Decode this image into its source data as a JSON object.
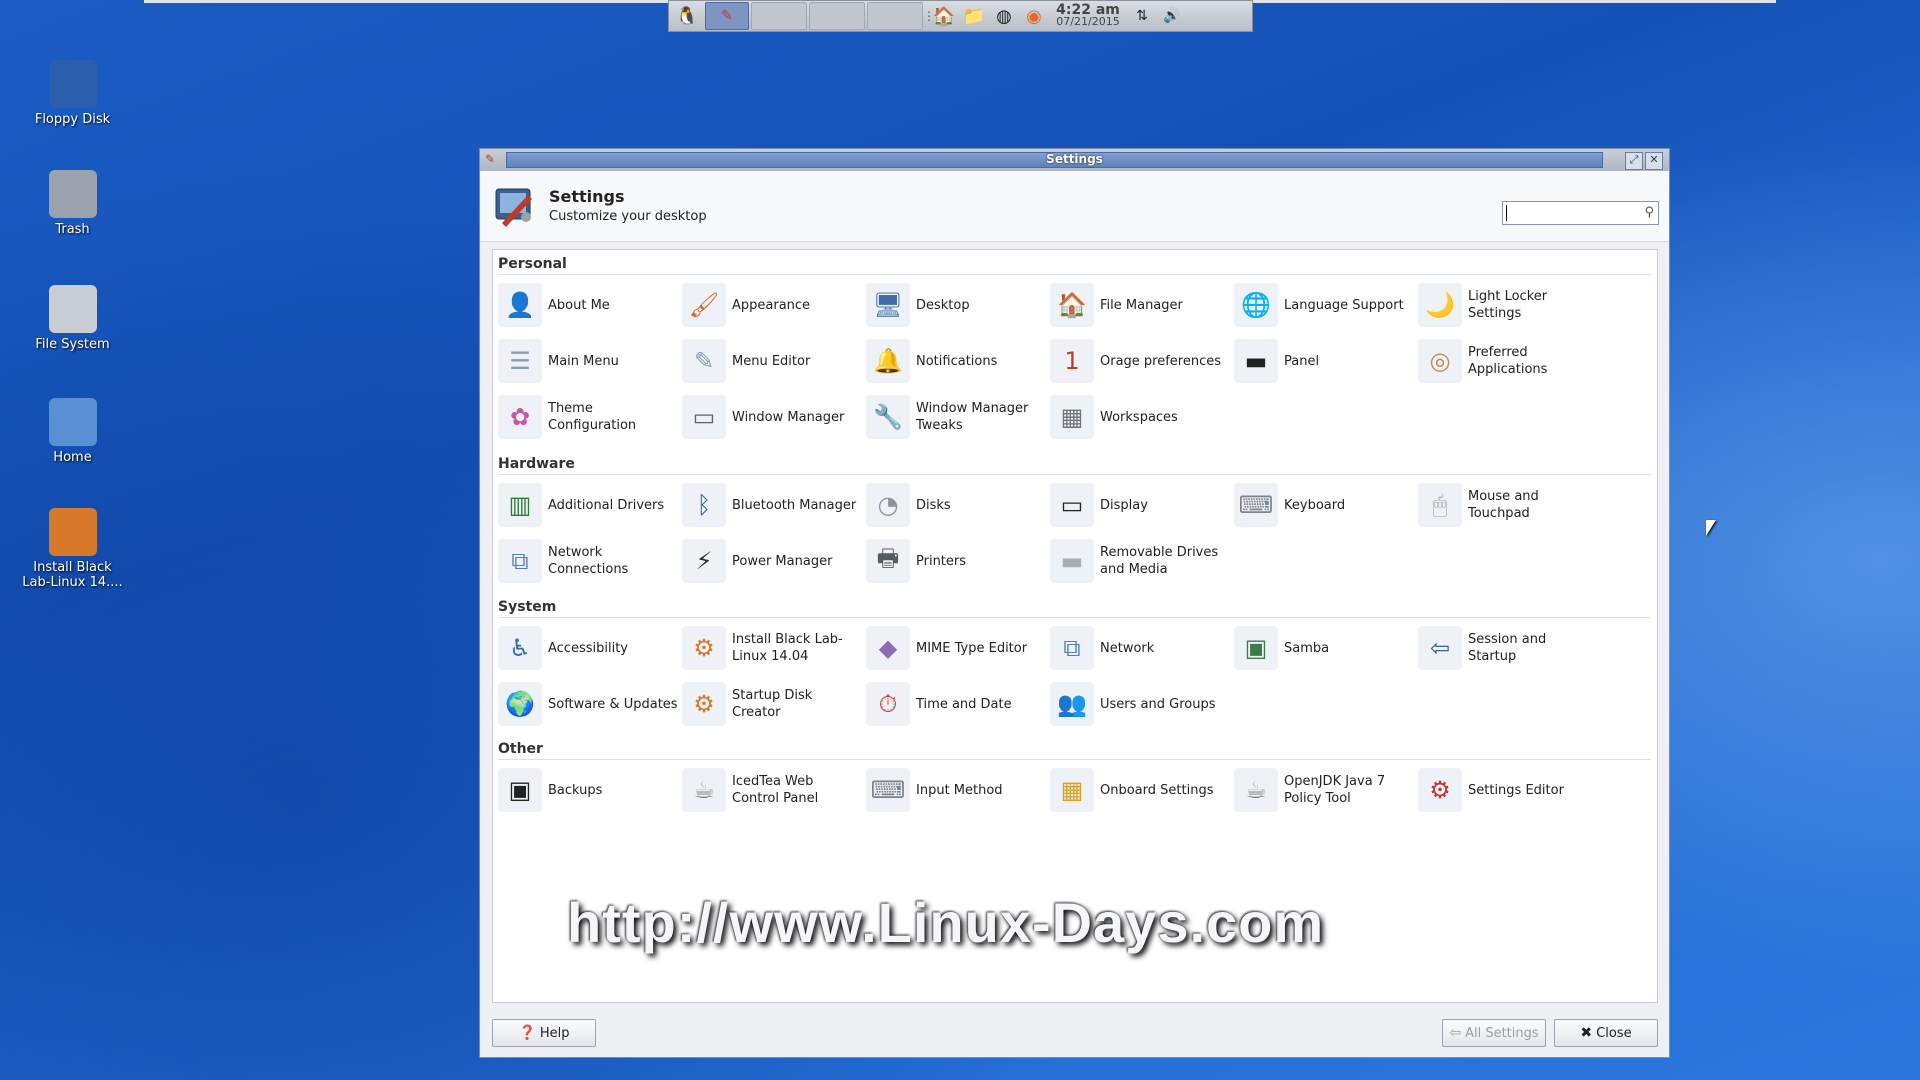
{
  "taskbar": {
    "clock_time": "4:22 am",
    "clock_date": "07/21/2015"
  },
  "desktop": {
    "icons": [
      {
        "label": "Floppy Disk",
        "icon": "floppy-disk-icon",
        "color": "#2b5fae"
      },
      {
        "label": "Trash",
        "icon": "trash-icon",
        "color": "#9aa3ad"
      },
      {
        "label": "File System",
        "icon": "drive-icon",
        "color": "#c9ced6"
      },
      {
        "label": "Home",
        "icon": "home-folder-icon",
        "color": "#5b8fd3"
      },
      {
        "label": "Install Black Lab-Linux 14....",
        "icon": "installer-icon",
        "color": "#d97a2b"
      }
    ]
  },
  "window": {
    "title": "Settings",
    "header_title": "Settings",
    "header_subtitle": "Customize your desktop",
    "search_placeholder": "",
    "sections": {
      "personal": "Personal",
      "hardware": "Hardware",
      "system": "System",
      "other": "Other"
    },
    "personal": [
      {
        "label": "About Me",
        "icon": "user-card-icon",
        "color": "#333333",
        "glyph": "👤"
      },
      {
        "label": "Appearance",
        "icon": "appearance-icon",
        "color": "#d9632b",
        "glyph": "🖌"
      },
      {
        "label": "Desktop",
        "icon": "monitor-icon",
        "color": "#3d6aa8",
        "glyph": "🖥"
      },
      {
        "label": "File Manager",
        "icon": "file-manager-icon",
        "color": "#4a7cc0",
        "glyph": "🏠"
      },
      {
        "label": "Language Support",
        "icon": "globe-icon",
        "color": "#2f6db8",
        "glyph": "🌐"
      },
      {
        "label": "Light Locker Settings",
        "icon": "lock-screen-icon",
        "color": "#2c3e66",
        "glyph": "🌙"
      },
      {
        "label": "Main Menu",
        "icon": "main-menu-icon",
        "color": "#8a9ab2",
        "glyph": "☰"
      },
      {
        "label": "Menu Editor",
        "icon": "menu-editor-icon",
        "color": "#8a9ab2",
        "glyph": "✎"
      },
      {
        "label": "Notifications",
        "icon": "notifications-icon",
        "color": "#6c7480",
        "glyph": "🔔"
      },
      {
        "label": "Orage preferences",
        "icon": "calendar-icon",
        "color": "#c0392b",
        "glyph": "1"
      },
      {
        "label": "Panel",
        "icon": "panel-icon",
        "color": "#222222",
        "glyph": "▬"
      },
      {
        "label": "Preferred Applications",
        "icon": "preferred-apps-icon",
        "color": "#b98b52",
        "glyph": "◎"
      },
      {
        "label": "Theme Configuration",
        "icon": "theme-icon",
        "color": "#c455a8",
        "glyph": "✿"
      },
      {
        "label": "Window Manager",
        "icon": "window-manager-icon",
        "color": "#5a6270",
        "glyph": "▭"
      },
      {
        "label": "Window Manager Tweaks",
        "icon": "wm-tweaks-icon",
        "color": "#5a6270",
        "glyph": "🔧"
      },
      {
        "label": "Workspaces",
        "icon": "workspaces-icon",
        "color": "#6c737d",
        "glyph": "▦"
      }
    ],
    "hardware": [
      {
        "label": "Additional Drivers",
        "icon": "drivers-icon",
        "color": "#2e7a3a",
        "glyph": "▥"
      },
      {
        "label": "Bluetooth Manager",
        "icon": "bluetooth-icon",
        "color": "#2b5ea8",
        "glyph": "ᛒ"
      },
      {
        "label": "Disks",
        "icon": "disks-icon",
        "color": "#8c939c",
        "glyph": "◔"
      },
      {
        "label": "Display",
        "icon": "display-icon",
        "color": "#222222",
        "glyph": "▭"
      },
      {
        "label": "Keyboard",
        "icon": "keyboard-icon",
        "color": "#7c838c",
        "glyph": "⌨"
      },
      {
        "label": "Mouse and Touchpad",
        "icon": "mouse-icon",
        "color": "#9aa1aa",
        "glyph": "🖱"
      },
      {
        "label": "Network Connections",
        "icon": "network-connections-icon",
        "color": "#4e7fbf",
        "glyph": "⧉"
      },
      {
        "label": "Power Manager",
        "icon": "power-icon",
        "color": "#333333",
        "glyph": "⚡"
      },
      {
        "label": "Printers",
        "icon": "printer-icon",
        "color": "#555c66",
        "glyph": "🖶"
      },
      {
        "label": "Removable Drives and Media",
        "icon": "removable-drive-icon",
        "color": "#a7adb5",
        "glyph": "▬"
      }
    ],
    "system": [
      {
        "label": "Accessibility",
        "icon": "accessibility-icon",
        "color": "#2f6db8",
        "glyph": "♿"
      },
      {
        "label": "Install Black Lab-Linux 14.04",
        "icon": "installer-icon",
        "color": "#d97a2b",
        "glyph": "⚙"
      },
      {
        "label": "MIME Type Editor",
        "icon": "mime-icon",
        "color": "#8e6bb5",
        "glyph": "◆"
      },
      {
        "label": "Network",
        "icon": "network-icon",
        "color": "#4e7fbf",
        "glyph": "⧉"
      },
      {
        "label": "Samba",
        "icon": "samba-icon",
        "color": "#3d7c4a",
        "glyph": "▣"
      },
      {
        "label": "Session and Startup",
        "icon": "session-icon",
        "color": "#3b5e8a",
        "glyph": "⇦"
      },
      {
        "label": "Software & Updates",
        "icon": "software-updates-icon",
        "color": "#b98b52",
        "glyph": "🌍"
      },
      {
        "label": "Startup Disk Creator",
        "icon": "startup-disk-icon",
        "color": "#d97a2b",
        "glyph": "⚙"
      },
      {
        "label": "Time and Date",
        "icon": "clock-icon",
        "color": "#c0392b",
        "glyph": "⏱"
      },
      {
        "label": "Users and Groups",
        "icon": "users-icon",
        "color": "#9aa1aa",
        "glyph": "👥"
      }
    ],
    "other": [
      {
        "label": "Backups",
        "icon": "backups-icon",
        "color": "#222222",
        "glyph": "▣"
      },
      {
        "label": "IcedTea Web Control Panel",
        "icon": "java-icon",
        "color": "#7a8089",
        "glyph": "☕"
      },
      {
        "label": "Input Method",
        "icon": "input-method-icon",
        "color": "#7c838c",
        "glyph": "⌨"
      },
      {
        "label": "Onboard Settings",
        "icon": "onboard-keyboard-icon",
        "color": "#e0a020",
        "glyph": "▦"
      },
      {
        "label": "OpenJDK Java 7 Policy Tool",
        "icon": "java-policy-icon",
        "color": "#7a8089",
        "glyph": "☕"
      },
      {
        "label": "Settings Editor",
        "icon": "settings-editor-icon",
        "color": "#c0392b",
        "glyph": "⚙"
      }
    ],
    "watermark": "http://www.Linux-Days.com",
    "buttons": {
      "help": "Help",
      "all_settings": "All Settings",
      "close": "Close"
    }
  }
}
